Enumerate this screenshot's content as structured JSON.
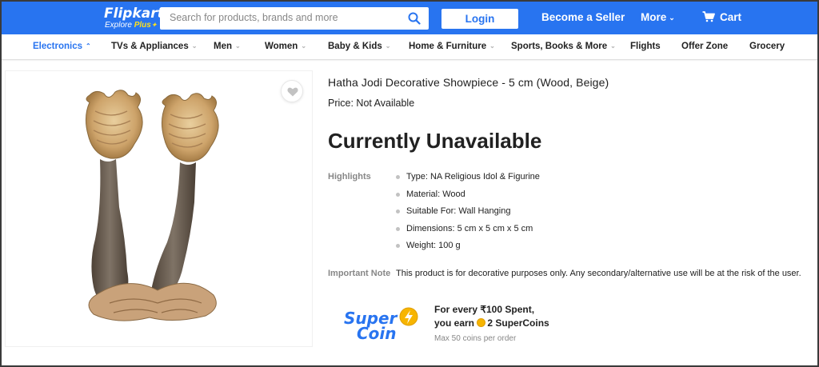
{
  "header": {
    "logo": "Flipkart",
    "logo_sub_prefix": "Explore",
    "logo_sub_plus": "Plus",
    "search_placeholder": "Search for products, brands and more",
    "login_label": "Login",
    "seller_label": "Become a Seller",
    "more_label": "More",
    "cart_label": "Cart",
    "brand_color": "#2874f0"
  },
  "nav": {
    "items": [
      {
        "label": "Electronics",
        "chevron": true,
        "active": true
      },
      {
        "label": "TVs & Appliances",
        "chevron": true
      },
      {
        "label": "Men",
        "chevron": true
      },
      {
        "label": "Women",
        "chevron": true
      },
      {
        "label": "Baby & Kids",
        "chevron": true
      },
      {
        "label": "Home & Furniture",
        "chevron": true
      },
      {
        "label": "Sports, Books & More",
        "chevron": true
      },
      {
        "label": "Flights",
        "chevron": false
      },
      {
        "label": "Offer Zone",
        "chevron": false
      },
      {
        "label": "Grocery",
        "chevron": false
      }
    ]
  },
  "product": {
    "title": "Hatha Jodi Decorative Showpiece  -  5 cm  (Wood, Beige)",
    "price": "Price: Not Available",
    "status": "Currently Unavailable",
    "highlights_label": "Highlights",
    "highlights": [
      "Type: NA Religious Idol & Figurine",
      "Material: Wood",
      "Suitable For: Wall Hanging",
      "Dimensions: 5 cm x 5 cm x 5 cm",
      "Weight: 100 g"
    ],
    "note_label": "Important Note",
    "note_text": "This product is for decorative purposes only. Any secondary/alternative use will be at the risk of the user."
  },
  "supercoin": {
    "logo_line1": "Super",
    "logo_line2": "Coin",
    "line1": "For every ₹100 Spent,",
    "line2_prefix": "you earn",
    "line2_suffix": "2 SuperCoins",
    "line3": "Max 50 coins per order"
  }
}
